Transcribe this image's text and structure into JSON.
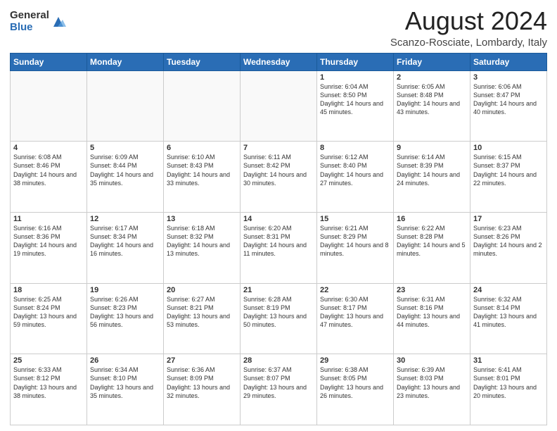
{
  "logo": {
    "general": "General",
    "blue": "Blue"
  },
  "title": "August 2024",
  "location": "Scanzo-Rosciate, Lombardy, Italy",
  "days_of_week": [
    "Sunday",
    "Monday",
    "Tuesday",
    "Wednesday",
    "Thursday",
    "Friday",
    "Saturday"
  ],
  "weeks": [
    [
      {
        "day": "",
        "info": ""
      },
      {
        "day": "",
        "info": ""
      },
      {
        "day": "",
        "info": ""
      },
      {
        "day": "",
        "info": ""
      },
      {
        "day": "1",
        "info": "Sunrise: 6:04 AM\nSunset: 8:50 PM\nDaylight: 14 hours\nand 45 minutes."
      },
      {
        "day": "2",
        "info": "Sunrise: 6:05 AM\nSunset: 8:48 PM\nDaylight: 14 hours\nand 43 minutes."
      },
      {
        "day": "3",
        "info": "Sunrise: 6:06 AM\nSunset: 8:47 PM\nDaylight: 14 hours\nand 40 minutes."
      }
    ],
    [
      {
        "day": "4",
        "info": "Sunrise: 6:08 AM\nSunset: 8:46 PM\nDaylight: 14 hours\nand 38 minutes."
      },
      {
        "day": "5",
        "info": "Sunrise: 6:09 AM\nSunset: 8:44 PM\nDaylight: 14 hours\nand 35 minutes."
      },
      {
        "day": "6",
        "info": "Sunrise: 6:10 AM\nSunset: 8:43 PM\nDaylight: 14 hours\nand 33 minutes."
      },
      {
        "day": "7",
        "info": "Sunrise: 6:11 AM\nSunset: 8:42 PM\nDaylight: 14 hours\nand 30 minutes."
      },
      {
        "day": "8",
        "info": "Sunrise: 6:12 AM\nSunset: 8:40 PM\nDaylight: 14 hours\nand 27 minutes."
      },
      {
        "day": "9",
        "info": "Sunrise: 6:14 AM\nSunset: 8:39 PM\nDaylight: 14 hours\nand 24 minutes."
      },
      {
        "day": "10",
        "info": "Sunrise: 6:15 AM\nSunset: 8:37 PM\nDaylight: 14 hours\nand 22 minutes."
      }
    ],
    [
      {
        "day": "11",
        "info": "Sunrise: 6:16 AM\nSunset: 8:36 PM\nDaylight: 14 hours\nand 19 minutes."
      },
      {
        "day": "12",
        "info": "Sunrise: 6:17 AM\nSunset: 8:34 PM\nDaylight: 14 hours\nand 16 minutes."
      },
      {
        "day": "13",
        "info": "Sunrise: 6:18 AM\nSunset: 8:32 PM\nDaylight: 14 hours\nand 13 minutes."
      },
      {
        "day": "14",
        "info": "Sunrise: 6:20 AM\nSunset: 8:31 PM\nDaylight: 14 hours\nand 11 minutes."
      },
      {
        "day": "15",
        "info": "Sunrise: 6:21 AM\nSunset: 8:29 PM\nDaylight: 14 hours\nand 8 minutes."
      },
      {
        "day": "16",
        "info": "Sunrise: 6:22 AM\nSunset: 8:28 PM\nDaylight: 14 hours\nand 5 minutes."
      },
      {
        "day": "17",
        "info": "Sunrise: 6:23 AM\nSunset: 8:26 PM\nDaylight: 14 hours\nand 2 minutes."
      }
    ],
    [
      {
        "day": "18",
        "info": "Sunrise: 6:25 AM\nSunset: 8:24 PM\nDaylight: 13 hours\nand 59 minutes."
      },
      {
        "day": "19",
        "info": "Sunrise: 6:26 AM\nSunset: 8:23 PM\nDaylight: 13 hours\nand 56 minutes."
      },
      {
        "day": "20",
        "info": "Sunrise: 6:27 AM\nSunset: 8:21 PM\nDaylight: 13 hours\nand 53 minutes."
      },
      {
        "day": "21",
        "info": "Sunrise: 6:28 AM\nSunset: 8:19 PM\nDaylight: 13 hours\nand 50 minutes."
      },
      {
        "day": "22",
        "info": "Sunrise: 6:30 AM\nSunset: 8:17 PM\nDaylight: 13 hours\nand 47 minutes."
      },
      {
        "day": "23",
        "info": "Sunrise: 6:31 AM\nSunset: 8:16 PM\nDaylight: 13 hours\nand 44 minutes."
      },
      {
        "day": "24",
        "info": "Sunrise: 6:32 AM\nSunset: 8:14 PM\nDaylight: 13 hours\nand 41 minutes."
      }
    ],
    [
      {
        "day": "25",
        "info": "Sunrise: 6:33 AM\nSunset: 8:12 PM\nDaylight: 13 hours\nand 38 minutes."
      },
      {
        "day": "26",
        "info": "Sunrise: 6:34 AM\nSunset: 8:10 PM\nDaylight: 13 hours\nand 35 minutes."
      },
      {
        "day": "27",
        "info": "Sunrise: 6:36 AM\nSunset: 8:09 PM\nDaylight: 13 hours\nand 32 minutes."
      },
      {
        "day": "28",
        "info": "Sunrise: 6:37 AM\nSunset: 8:07 PM\nDaylight: 13 hours\nand 29 minutes."
      },
      {
        "day": "29",
        "info": "Sunrise: 6:38 AM\nSunset: 8:05 PM\nDaylight: 13 hours\nand 26 minutes."
      },
      {
        "day": "30",
        "info": "Sunrise: 6:39 AM\nSunset: 8:03 PM\nDaylight: 13 hours\nand 23 minutes."
      },
      {
        "day": "31",
        "info": "Sunrise: 6:41 AM\nSunset: 8:01 PM\nDaylight: 13 hours\nand 20 minutes."
      }
    ]
  ]
}
